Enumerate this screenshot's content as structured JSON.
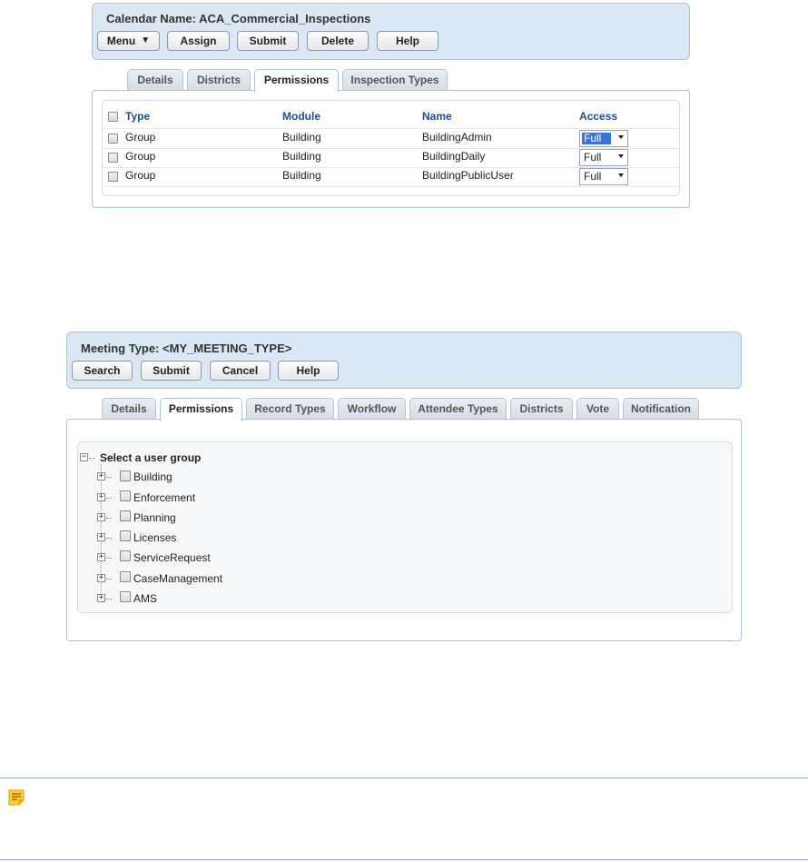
{
  "calendar": {
    "title": "Calendar Name: ACA_Commercial_Inspections",
    "buttons": {
      "menu": "Menu",
      "assign": "Assign",
      "submit": "Submit",
      "delete": "Delete",
      "help": "Help"
    },
    "tabs": [
      "Details",
      "Districts",
      "Permissions",
      "Inspection Types"
    ],
    "active_tab": "Permissions",
    "table": {
      "headers": {
        "type": "Type",
        "module": "Module",
        "name": "Name",
        "access": "Access"
      },
      "rows": [
        {
          "type": "Group",
          "module": "Building",
          "name": "BuildingAdmin",
          "access": "Full",
          "highlighted": true
        },
        {
          "type": "Group",
          "module": "Building",
          "name": "BuildingDaily",
          "access": "Full",
          "highlighted": false
        },
        {
          "type": "Group",
          "module": "Building",
          "name": "BuildingPublicUser",
          "access": "Full",
          "highlighted": false
        }
      ]
    }
  },
  "meeting": {
    "title": "Meeting Type: <MY_MEETING_TYPE>",
    "buttons": {
      "search": "Search",
      "submit": "Submit",
      "cancel": "Cancel",
      "help": "Help"
    },
    "tabs": [
      "Details",
      "Permissions",
      "Record Types",
      "Workflow",
      "Attendee Types",
      "Districts",
      "Vote",
      "Notification"
    ],
    "active_tab": "Permissions",
    "tree": {
      "root_label": "Select a user group",
      "groups": [
        "Building",
        "Enforcement",
        "Planning",
        "Licenses",
        "ServiceRequest",
        "CaseManagement",
        "AMS"
      ]
    }
  },
  "note": {
    "icon": "note-icon"
  },
  "colors": {
    "panel_bg": "#dae8f6",
    "header_text": "#1f4e8c",
    "note_icon": "#f5b400"
  }
}
